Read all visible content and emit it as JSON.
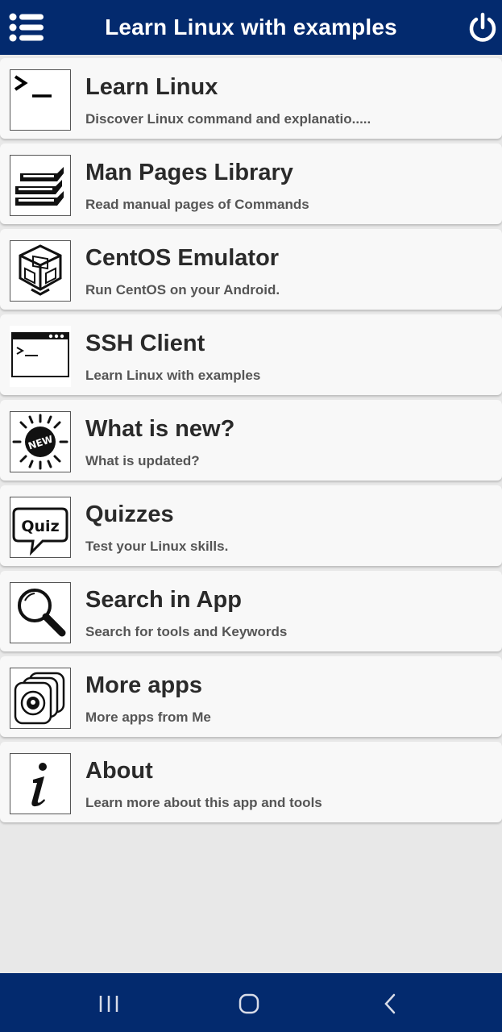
{
  "app_bar": {
    "title": "Learn Linux with examples",
    "menu_icon": "list-menu-icon",
    "power_icon": "power-icon",
    "background": "#032a6e"
  },
  "items": [
    {
      "title": "Learn Linux",
      "subtitle": "Discover Linux command and explanatio.....",
      "icon": "terminal-prompt-icon"
    },
    {
      "title": "Man Pages Library",
      "subtitle": "Read manual pages of Commands",
      "icon": "books-stack-icon"
    },
    {
      "title": "CentOS Emulator",
      "subtitle": "Run CentOS on your Android.",
      "icon": "virtual-box-icon"
    },
    {
      "title": "SSH Client",
      "subtitle": "Learn Linux with examples",
      "icon": "terminal-window-icon"
    },
    {
      "title": "What is new?",
      "subtitle": "What is updated?",
      "icon": "new-badge-icon"
    },
    {
      "title": "Quizzes",
      "subtitle": "Test your Linux skills.",
      "icon": "quiz-bubble-icon"
    },
    {
      "title": "Search in App",
      "subtitle": "Search for tools and Keywords",
      "icon": "magnifier-icon"
    },
    {
      "title": "More apps",
      "subtitle": "More apps from Me",
      "icon": "app-cards-icon"
    },
    {
      "title": "About",
      "subtitle": "Learn more about this app and tools",
      "icon": "info-icon"
    }
  ],
  "nav_bar": {
    "recents_icon": "recent-apps-icon",
    "home_icon": "home-icon",
    "back_icon": "back-icon"
  }
}
